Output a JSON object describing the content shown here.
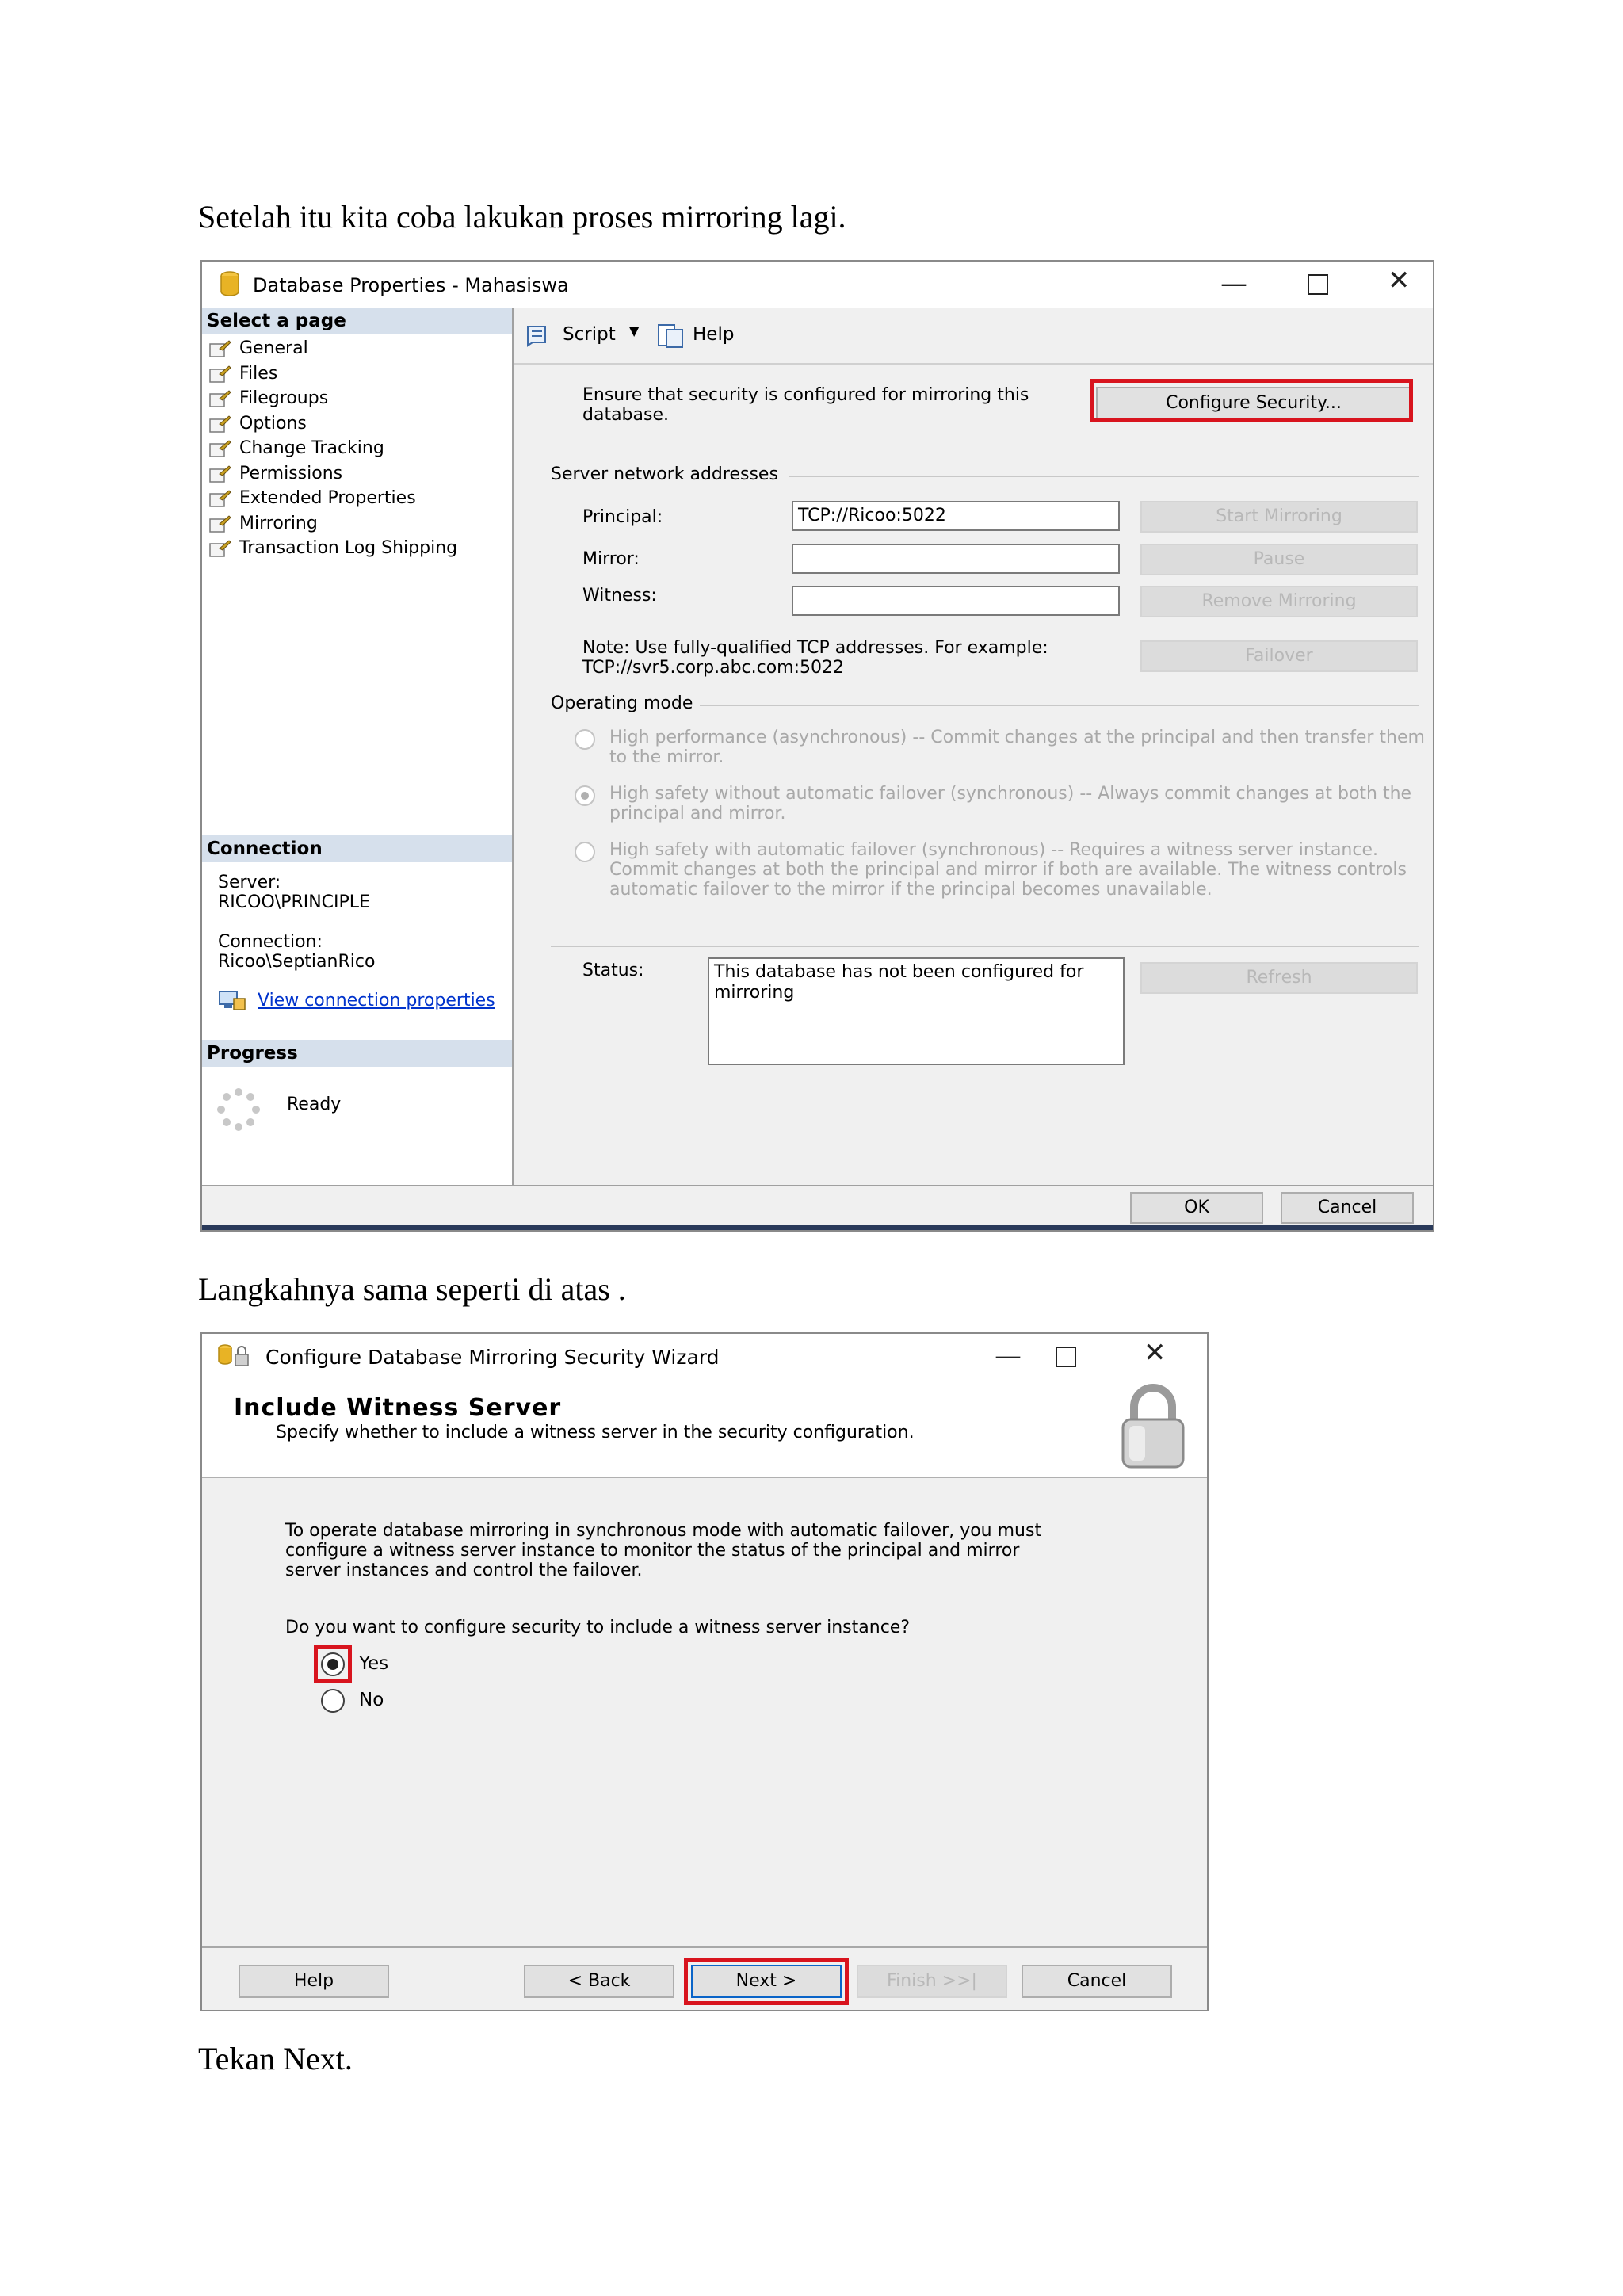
{
  "doc": {
    "para1": "Setelah itu kita coba lakukan proses mirroring lagi.",
    "para2": "Langkahnya sama seperti di atas .",
    "para3": "Tekan Next."
  },
  "win1": {
    "title": "Database Properties - Mahasiswa",
    "select_page_header": "Select a page",
    "pages": [
      "General",
      "Files",
      "Filegroups",
      "Options",
      "Change Tracking",
      "Permissions",
      "Extended Properties",
      "Mirroring",
      "Transaction Log Shipping"
    ],
    "connection_header": "Connection",
    "server_label": "Server:",
    "server_value": "RICOO\\PRINCIPLE",
    "connection_label": "Connection:",
    "connection_value": "Ricoo\\SeptianRico",
    "view_connection": "View connection properties",
    "progress_header": "Progress",
    "progress_status": "Ready",
    "toolbar": {
      "script": "Script",
      "help": "Help"
    },
    "security_note_1": "Ensure that security is configured for mirroring this",
    "security_note_2": "database.",
    "configure_security": "Configure Security...",
    "server_network_addresses": "Server network addresses",
    "principal_label": "Principal:",
    "principal_value": "TCP://Ricoo:5022",
    "mirror_label": "Mirror:",
    "mirror_value": "",
    "witness_label": "Witness:",
    "witness_value": "",
    "start_mirroring": "Start Mirroring",
    "pause": "Pause",
    "remove_mirroring": "Remove Mirroring",
    "failover": "Failover",
    "note_1": "Note: Use fully-qualified TCP addresses. For example:",
    "note_2": "TCP://svr5.corp.abc.com:5022",
    "operating_mode": "Operating mode",
    "mode_high_perf_1": "High performance (asynchronous) -- Commit changes at the principal and then transfer them",
    "mode_high_perf_2": "to the mirror.",
    "mode_high_safety_1": "High safety without automatic failover (synchronous) -- Always commit changes at both the",
    "mode_high_safety_2": "principal and mirror.",
    "mode_auto_1": "High safety with automatic failover (synchronous) -- Requires a witness server instance.",
    "mode_auto_2": "Commit changes at both the principal and mirror if both are available. The witness controls",
    "mode_auto_3": "automatic failover to the mirror if the principal becomes unavailable.",
    "status_label": "Status:",
    "status_value": "This database has not been configured for mirroring",
    "refresh": "Refresh",
    "ok": "OK",
    "cancel": "Cancel"
  },
  "win2": {
    "title": "Configure Database Mirroring Security Wizard",
    "heading": "Include Witness Server",
    "subheading": "Specify whether to include a witness server in the security configuration.",
    "body_1": "To operate database mirroring in synchronous mode with automatic failover, you must",
    "body_2": "configure a witness server instance to monitor the status of the principal and mirror",
    "body_3": "server instances and control the failover.",
    "question": "Do you want to configure security to include a witness server instance?",
    "yes": "Yes",
    "no": "No",
    "help": "Help",
    "back": "< Back",
    "next": "Next >",
    "finish": "Finish >>|",
    "cancel": "Cancel"
  }
}
